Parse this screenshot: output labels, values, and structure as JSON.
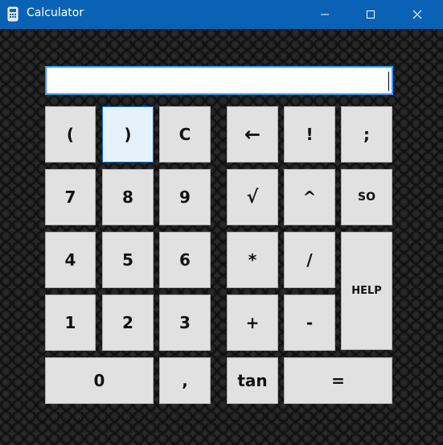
{
  "window": {
    "title": "Calculator",
    "icon": "calculator-icon",
    "titlebar_color": "#0a62b6"
  },
  "display": {
    "value": ""
  },
  "keys": {
    "open_paren": "(",
    "close_paren": ")",
    "clear": "C",
    "backspace": "←",
    "factorial": "!",
    "semicolon": ";",
    "seven": "7",
    "eight": "8",
    "nine": "9",
    "sqrt": "√",
    "power": "^",
    "so": "SO",
    "four": "4",
    "five": "5",
    "six": "6",
    "multiply": "*",
    "divide": "/",
    "help": "HELP",
    "one": "1",
    "two": "2",
    "three": "3",
    "plus": "+",
    "minus": "-",
    "zero": "0",
    "comma": ",",
    "tan": "tan",
    "equals": "="
  },
  "colors": {
    "key_face": "#e1e1e1",
    "key_border": "#adadad",
    "focus_border": "#0078d7",
    "display_border": "#3399ff"
  }
}
